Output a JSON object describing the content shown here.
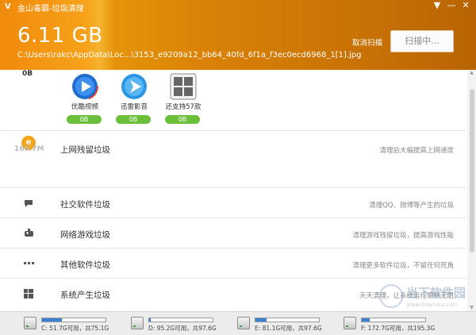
{
  "window": {
    "title": "金山毒霸-垃圾清理",
    "controls": [
      "▼",
      "—",
      "✕"
    ]
  },
  "header": {
    "total_size": "6.11 GB",
    "scan_path": "C:\\Users\\rakc\\AppData\\Loc...\\3153_e9209a12_bb64_40fd_6f1a_f3ec0ecd6968_1[1].jpg",
    "cancel_label": "取消扫描",
    "scan_button_label": "扫描中..."
  },
  "section_prev": {
    "size": "0B",
    "apps": [
      {
        "name": "优酷视频",
        "size": "0B",
        "icon": "youku-icon",
        "color": "#2a7dd6"
      },
      {
        "name": "迅雷影音",
        "size": "0B",
        "icon": "xunlei-icon",
        "color": "#2c9de8"
      },
      {
        "name": "还支持57款",
        "size": "0B",
        "icon": "more-apps-icon",
        "color": "#666666"
      }
    ]
  },
  "categories": [
    {
      "key": "internet",
      "title": "上网残留垃圾",
      "desc": "清理后大幅提高上网速度",
      "size": "160.7M",
      "icon": "ie-icon"
    },
    {
      "key": "social",
      "title": "社交软件垃圾",
      "desc": "清理QQ、微博等产生的垃圾",
      "icon": "chat-icon"
    },
    {
      "key": "games",
      "title": "网络游戏垃圾",
      "desc": "清理游戏残留垃圾，提高游戏性能",
      "icon": "gamepad-icon"
    },
    {
      "key": "other",
      "title": "其他软件垃圾",
      "desc": "清理更多软件垃圾，不留任何死角",
      "icon": "dots-icon"
    },
    {
      "key": "system",
      "title": "系统产生垃圾",
      "desc": "天天清理，让系统运行顺畅无阻",
      "icon": "windows-icon"
    }
  ],
  "drives": [
    {
      "label": "C: 51.7G可用，共75.1G",
      "used_fraction": 0.31
    },
    {
      "label": "D: 95.2G可用，共97.6G",
      "used_fraction": 0.03
    },
    {
      "label": "E: 81.1G可用，共97.6G",
      "used_fraction": 0.17
    },
    {
      "label": "F: 172.7G可用，共195.3G",
      "used_fraction": 0.12
    }
  ],
  "watermark": {
    "text": "当下软件园",
    "sub": "www.downxia.com"
  },
  "colors": {
    "header_orange": "#e08a0a",
    "badge_green": "#6bbf3a",
    "drive_fill": "#3b7fd6"
  }
}
